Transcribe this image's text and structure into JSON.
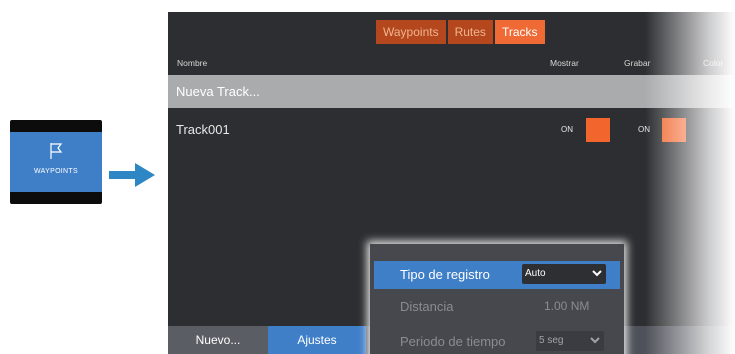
{
  "launcher": {
    "label": "WAYPOINTS",
    "icon": "flag-icon"
  },
  "arrow_icon": "arrow-right-icon",
  "tabs": [
    {
      "label": "Waypoints",
      "active": false
    },
    {
      "label": "Rutes",
      "active": false
    },
    {
      "label": "Tracks",
      "active": true
    }
  ],
  "columns": {
    "nombre": "Nombre",
    "mostrar": "Mostrar",
    "grabar": "Grabar",
    "color": "Color"
  },
  "new_track": "Nueva Track...",
  "tracks": [
    {
      "name": "Track001",
      "mostrar": "ON",
      "grabar": "ON"
    }
  ],
  "bottom_bar": {
    "nuevo": "Nuevo...",
    "ajustes": "Ajustes"
  },
  "popup": {
    "tipo_label": "Tipo de registro",
    "tipo_value": "Auto",
    "distancia_label": "Distancia",
    "distancia_value": "1.00 NM",
    "periodo_label": "Periodo de tiempo",
    "periodo_value": "5 seg"
  },
  "colors": {
    "accent_orange": "#ef6a35",
    "tab_inactive": "#b4471d",
    "selection_blue": "#3f7fc8",
    "screen_bg": "#2d2e31"
  }
}
